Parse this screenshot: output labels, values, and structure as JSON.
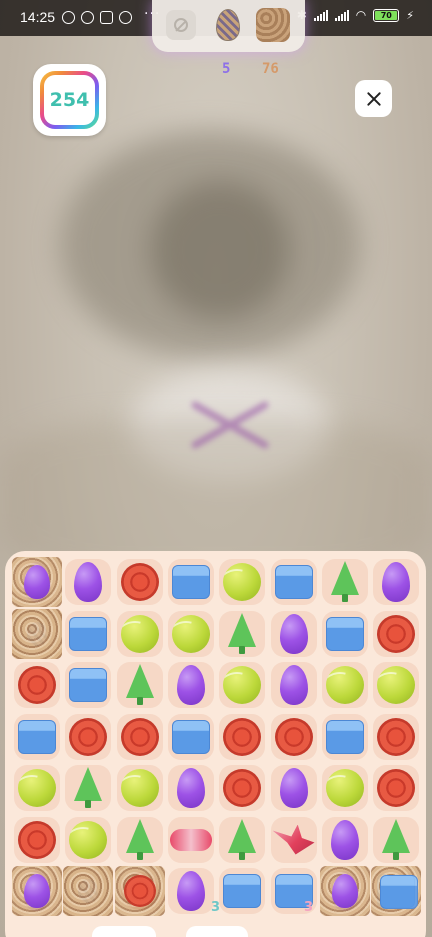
{
  "status_bar": {
    "time": "14:25",
    "dots": "···",
    "battery": "70"
  },
  "goals": {
    "egg_count": "5",
    "cork_count": "76"
  },
  "moves": "254",
  "hints": {
    "left": "3",
    "right": "3"
  },
  "board": {
    "rows": [
      [
        "egg",
        "egg",
        "disc",
        "box",
        "ball",
        "box",
        "tree",
        "egg"
      ],
      [
        "cork",
        "box",
        "ball",
        "ball",
        "tree",
        "egg",
        "box",
        "disc"
      ],
      [
        "disc",
        "box",
        "tree",
        "egg",
        "ball",
        "egg",
        "ball",
        "ball"
      ],
      [
        "box",
        "disc",
        "disc",
        "box",
        "disc",
        "disc",
        "box",
        "disc"
      ],
      [
        "ball",
        "tree",
        "ball",
        "egg",
        "disc",
        "egg",
        "ball",
        "disc"
      ],
      [
        "disc",
        "ball",
        "tree",
        "candy",
        "tree",
        "crane",
        "egg",
        "tree"
      ],
      [
        "egg",
        "cork",
        "disc",
        "egg",
        "box",
        "box",
        "egg",
        "box"
      ]
    ]
  }
}
